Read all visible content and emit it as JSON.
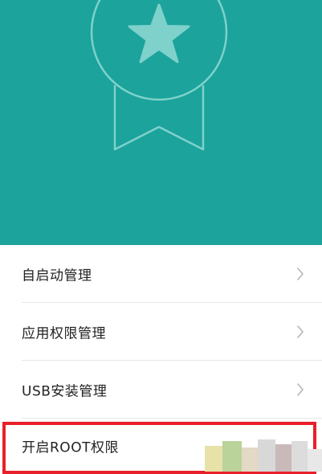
{
  "header": {
    "badge_icon": "award-badge-star-icon",
    "background_color": "#1ba39c",
    "outline_color": "#7fd1cb"
  },
  "menu": {
    "items": [
      {
        "label": "自启动管理",
        "icon": "chevron-right-icon"
      },
      {
        "label": "应用权限管理",
        "icon": "chevron-right-icon"
      },
      {
        "label": "USB安装管理",
        "icon": "chevron-right-icon"
      },
      {
        "label": "开启ROOT权限"
      }
    ]
  },
  "highlight": {
    "color": "#e8202a"
  }
}
